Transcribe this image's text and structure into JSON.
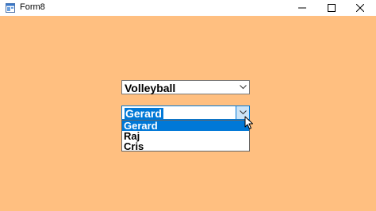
{
  "window": {
    "title": "Form8",
    "icon": "winforms-form-icon",
    "controls": [
      "minimize-icon",
      "maximize-icon",
      "close-icon"
    ]
  },
  "colors": {
    "client_bg": "#ffbf80",
    "selection": "#0078d7"
  },
  "sport_combo": {
    "value": "Volleyball",
    "icon": "chevron-down-icon"
  },
  "name_combo": {
    "value": "Gerard",
    "icon": "chevron-down-icon",
    "expanded": true,
    "options": [
      "Gerard",
      "Raj",
      "Cris"
    ],
    "selected_index": 0
  },
  "cursor": {
    "icon": "mouse-pointer-icon"
  }
}
